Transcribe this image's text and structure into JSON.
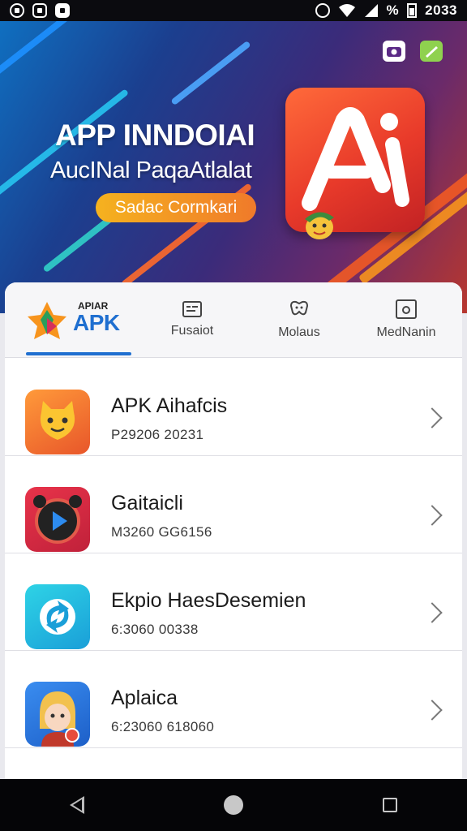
{
  "status_bar": {
    "icons": [
      "android-icon",
      "shield-icon",
      "notification-icon"
    ],
    "right_icons": [
      "alarm-icon",
      "wifi-icon",
      "signal-icon",
      "battery-icon"
    ],
    "percent": "%",
    "time": "2033"
  },
  "hero": {
    "title": "APP INNDOIAI",
    "subtitle": "AucINal PaqaAtlalat",
    "cta_label": "Sadac Cormkari",
    "logo_letters": "Ai",
    "top_right_icons": [
      "camera-icon",
      "edit-icon"
    ],
    "colors": {
      "brand_red": "#e83a2a",
      "cta_orange": "#f5b21f"
    }
  },
  "tabs": {
    "brand_small": "APIAR",
    "brand_big": "APK",
    "items": [
      {
        "label": "Fusaiot",
        "icon": "list-icon"
      },
      {
        "label": "Molaus",
        "icon": "gamepad-icon"
      },
      {
        "label": "MedNanin",
        "icon": "media-icon"
      }
    ],
    "active_color": "#1f6fd0"
  },
  "apps": [
    {
      "title": "APK Aihafcis",
      "meta": "P29206 20231",
      "icon": "cat-app-icon"
    },
    {
      "title": "Gaitaicli",
      "meta": "M3260 GG6156",
      "icon": "play-app-icon"
    },
    {
      "title": "Ekpio HaesDesemien",
      "meta": "6:3060 00338",
      "icon": "refresh-app-icon"
    },
    {
      "title": "Aplaica",
      "meta": "6:23060 618060",
      "icon": "avatar-app-icon"
    }
  ],
  "nav": {
    "items": [
      "back-icon",
      "home-icon",
      "recents-icon"
    ]
  }
}
